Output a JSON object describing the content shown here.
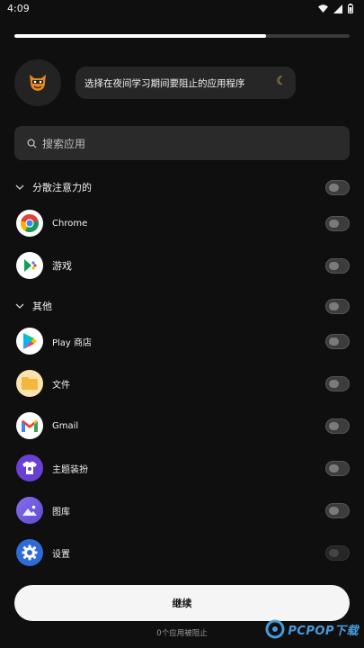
{
  "status_bar": {
    "time": "4:09"
  },
  "progress": {
    "fraction": 0.75
  },
  "bubble": {
    "text": "选择在夜间学习期间要阻止的应用程序"
  },
  "search": {
    "placeholder": "搜索应用"
  },
  "groups": [
    {
      "label": "分散注意力的"
    },
    {
      "label": "其他"
    }
  ],
  "apps": [
    {
      "label": "Chrome",
      "icon": "chrome-icon"
    },
    {
      "label": "游戏",
      "icon": "games-icon"
    },
    {
      "label": "Play 商店",
      "icon": "play-store-icon"
    },
    {
      "label": "文件",
      "icon": "files-icon"
    },
    {
      "label": "Gmail",
      "icon": "gmail-icon"
    },
    {
      "label": "主题装扮",
      "icon": "theme-icon"
    },
    {
      "label": "图库",
      "icon": "gallery-icon"
    },
    {
      "label": "设置",
      "icon": "settings-icon"
    }
  ],
  "footer": {
    "continue_label": "继续",
    "blocked_count": "0个应用被阻止"
  },
  "watermark": {
    "text": "PCPOP下载"
  },
  "colors": {
    "background": "#0f0f0f",
    "toggle_off": "#3c3c3c",
    "accent_moon": "#f3c85a"
  }
}
